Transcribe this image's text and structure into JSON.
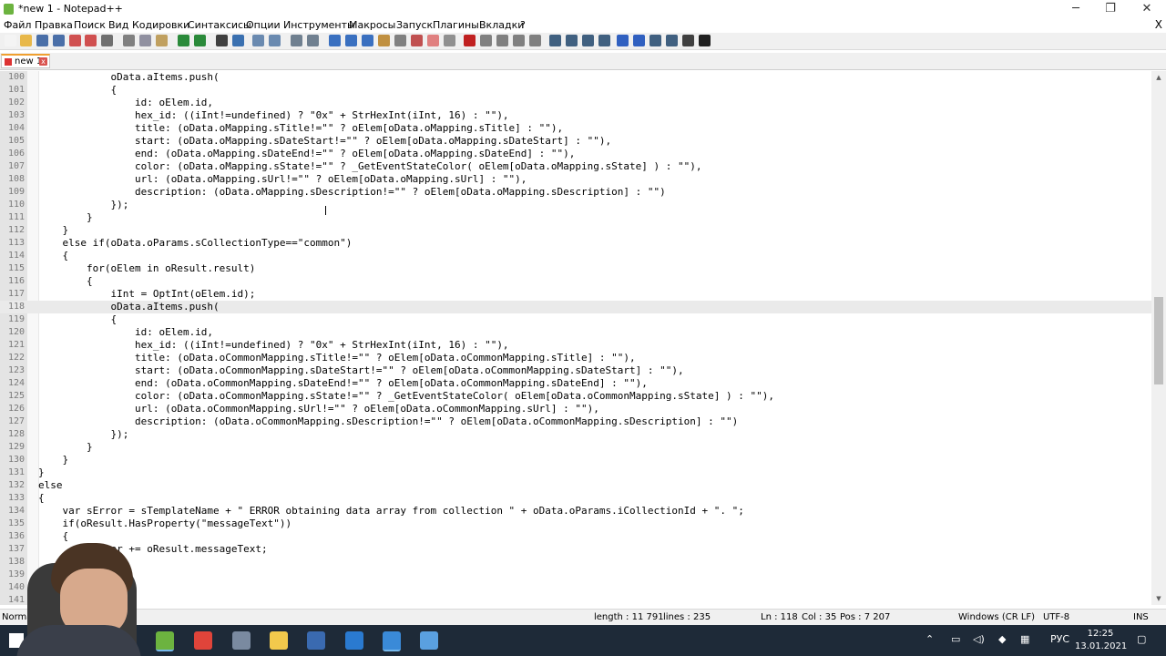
{
  "window": {
    "title": "*new 1 - Notepad++",
    "controls": {
      "minimize": "─",
      "maximize": "❐",
      "close": "✕"
    }
  },
  "menu": {
    "items": [
      "Файл",
      "Правка",
      "Поиск",
      "Вид",
      "Кодировки",
      "Синтаксисы",
      "Опции",
      "Инструменты",
      "Макросы",
      "Запуск",
      "Плагины",
      "Вкладки",
      "?"
    ],
    "close": "X"
  },
  "toolbar": {
    "icons": [
      {
        "name": "new-file-icon",
        "color": "#f4f4f4"
      },
      {
        "name": "open-file-icon",
        "color": "#e8b84a"
      },
      {
        "name": "save-icon",
        "color": "#4a6fa8"
      },
      {
        "name": "save-all-icon",
        "color": "#4a6fa8"
      },
      {
        "name": "close-file-icon",
        "color": "#d05050"
      },
      {
        "name": "close-all-icon",
        "color": "#d05050"
      },
      {
        "name": "print-icon",
        "color": "#707070"
      },
      {
        "name": "cut-icon",
        "color": "#808080"
      },
      {
        "name": "copy-icon",
        "color": "#9090a0"
      },
      {
        "name": "paste-icon",
        "color": "#c0a060"
      },
      {
        "name": "undo-icon",
        "color": "#2a8a3a"
      },
      {
        "name": "redo-icon",
        "color": "#2a8a3a"
      },
      {
        "name": "find-icon",
        "color": "#404040"
      },
      {
        "name": "replace-icon",
        "color": "#3a70b0"
      },
      {
        "name": "zoom-in-icon",
        "color": "#6a8ab0"
      },
      {
        "name": "zoom-out-icon",
        "color": "#6a8ab0"
      },
      {
        "name": "sync-vertical-icon",
        "color": "#708090"
      },
      {
        "name": "sync-horizontal-icon",
        "color": "#708090"
      },
      {
        "name": "word-wrap-icon",
        "color": "#3a70c0"
      },
      {
        "name": "show-all-chars-icon",
        "color": "#3a70c0"
      },
      {
        "name": "indent-guide-icon",
        "color": "#3a70c0"
      },
      {
        "name": "udl-icon",
        "color": "#c09040"
      },
      {
        "name": "doc-map-icon",
        "color": "#808080"
      },
      {
        "name": "function-list-icon",
        "color": "#c05050"
      },
      {
        "name": "folder-workspace-icon",
        "color": "#e08080"
      },
      {
        "name": "monitoring-icon",
        "color": "#909090"
      },
      {
        "name": "record-macro-icon",
        "color": "#c02020"
      },
      {
        "name": "stop-macro-icon",
        "color": "#808080"
      },
      {
        "name": "play-macro-icon",
        "color": "#808080"
      },
      {
        "name": "run-macro-multiple-icon",
        "color": "#808080"
      },
      {
        "name": "save-macro-icon",
        "color": "#808080"
      },
      {
        "name": "plugin-icon-1",
        "color": "#406080"
      },
      {
        "name": "plugin-icon-2",
        "color": "#406080"
      },
      {
        "name": "plugin-icon-3",
        "color": "#406080"
      },
      {
        "name": "plugin-icon-4",
        "color": "#406080"
      },
      {
        "name": "arrow-up-icon",
        "color": "#3060c0"
      },
      {
        "name": "arrow-down-icon",
        "color": "#3060c0"
      },
      {
        "name": "plugin-icon-5",
        "color": "#406080"
      },
      {
        "name": "plugin-icon-6",
        "color": "#406080"
      },
      {
        "name": "spell-check-icon",
        "color": "#404040"
      },
      {
        "name": "help-icon",
        "color": "#202020"
      }
    ]
  },
  "tabs": [
    {
      "label": "new 1",
      "close": "x"
    }
  ],
  "editor": {
    "current_line": "118",
    "lines": [
      {
        "n": "100",
        "t": "            oData.aItems.push("
      },
      {
        "n": "101",
        "t": "            {"
      },
      {
        "n": "102",
        "t": "                id: oElem.id,"
      },
      {
        "n": "103",
        "t": "                hex_id: ((iInt!=undefined) ? \"0x\" + StrHexInt(iInt, 16) : \"\"),"
      },
      {
        "n": "104",
        "t": "                title: (oData.oMapping.sTitle!=\"\" ? oElem[oData.oMapping.sTitle] : \"\"),"
      },
      {
        "n": "105",
        "t": "                start: (oData.oMapping.sDateStart!=\"\" ? oElem[oData.oMapping.sDateStart] : \"\"),"
      },
      {
        "n": "106",
        "t": "                end: (oData.oMapping.sDateEnd!=\"\" ? oElem[oData.oMapping.sDateEnd] : \"\"),"
      },
      {
        "n": "107",
        "t": "                color: (oData.oMapping.sState!=\"\" ? _GetEventStateColor( oElem[oData.oMapping.sState] ) : \"\"),"
      },
      {
        "n": "108",
        "t": "                url: (oData.oMapping.sUrl!=\"\" ? oElem[oData.oMapping.sUrl] : \"\"),"
      },
      {
        "n": "109",
        "t": "                description: (oData.oMapping.sDescription!=\"\" ? oElem[oData.oMapping.sDescription] : \"\")"
      },
      {
        "n": "110",
        "t": "            });"
      },
      {
        "n": "111",
        "t": "        }"
      },
      {
        "n": "112",
        "t": "    }"
      },
      {
        "n": "113",
        "t": "    else if(oData.oParams.sCollectionType==\"common\")"
      },
      {
        "n": "114",
        "t": "    {"
      },
      {
        "n": "115",
        "t": "        for(oElem in oResult.result)"
      },
      {
        "n": "116",
        "t": "        {"
      },
      {
        "n": "117",
        "t": "            iInt = OptInt(oElem.id);"
      },
      {
        "n": "118",
        "t": "            oData.aItems.push("
      },
      {
        "n": "119",
        "t": "            {"
      },
      {
        "n": "120",
        "t": "                id: oElem.id,"
      },
      {
        "n": "121",
        "t": "                hex_id: ((iInt!=undefined) ? \"0x\" + StrHexInt(iInt, 16) : \"\"),"
      },
      {
        "n": "122",
        "t": "                title: (oData.oCommonMapping.sTitle!=\"\" ? oElem[oData.oCommonMapping.sTitle] : \"\"),"
      },
      {
        "n": "123",
        "t": "                start: (oData.oCommonMapping.sDateStart!=\"\" ? oElem[oData.oCommonMapping.sDateStart] : \"\"),"
      },
      {
        "n": "124",
        "t": "                end: (oData.oCommonMapping.sDateEnd!=\"\" ? oElem[oData.oCommonMapping.sDateEnd] : \"\"),"
      },
      {
        "n": "125",
        "t": "                color: (oData.oCommonMapping.sState!=\"\" ? _GetEventStateColor( oElem[oData.oCommonMapping.sState] ) : \"\"),"
      },
      {
        "n": "126",
        "t": "                url: (oData.oCommonMapping.sUrl!=\"\" ? oElem[oData.oCommonMapping.sUrl] : \"\"),"
      },
      {
        "n": "127",
        "t": "                description: (oData.oCommonMapping.sDescription!=\"\" ? oElem[oData.oCommonMapping.sDescription] : \"\")"
      },
      {
        "n": "128",
        "t": "            });"
      },
      {
        "n": "129",
        "t": "        }"
      },
      {
        "n": "130",
        "t": "    }"
      },
      {
        "n": "131",
        "t": "}"
      },
      {
        "n": "132",
        "t": "else"
      },
      {
        "n": "133",
        "t": "{"
      },
      {
        "n": "134",
        "t": "    var sError = sTemplateName + \" ERROR obtaining data array from collection \" + oData.oParams.iCollectionId + \". \";"
      },
      {
        "n": "135",
        "t": "    if(oResult.HasProperty(\"messageText\"))"
      },
      {
        "n": "136",
        "t": "    {"
      },
      {
        "n": "137",
        "t": "        sError += oResult.messageText;"
      },
      {
        "n": "138",
        "t": ""
      },
      {
        "n": "139",
        "t": "        sError;"
      },
      {
        "n": "140",
        "t": ""
      },
      {
        "n": "141",
        "t": ""
      }
    ]
  },
  "status": {
    "mode": "Normal",
    "length": "length : 11 791",
    "lines": "lines : 235",
    "ln": "Ln : 118",
    "col": "Col : 35",
    "pos": "Pos : 7 207",
    "eol": "Windows (CR LF)",
    "encoding": "UTF-8",
    "ins": "INS"
  },
  "taskbar": {
    "apps": [
      {
        "name": "windows-start-icon",
        "color": "#ffffff"
      },
      {
        "name": "notepadpp-taskbar-icon",
        "color": "#6cb33f"
      },
      {
        "name": "chrome-icon",
        "color": "#e0443a"
      },
      {
        "name": "app-icon-1",
        "color": "#7a8aa0"
      },
      {
        "name": "explorer-icon",
        "color": "#f2c94c"
      },
      {
        "name": "app-icon-2",
        "color": "#3a6ab0"
      },
      {
        "name": "app-icon-3",
        "color": "#2a7ad0"
      },
      {
        "name": "app-icon-4",
        "color": "#3a8ad8"
      },
      {
        "name": "app-icon-5",
        "color": "#5aa0e0"
      }
    ],
    "lang": "РУС",
    "time": "12:25",
    "date": "13.01.2021"
  }
}
